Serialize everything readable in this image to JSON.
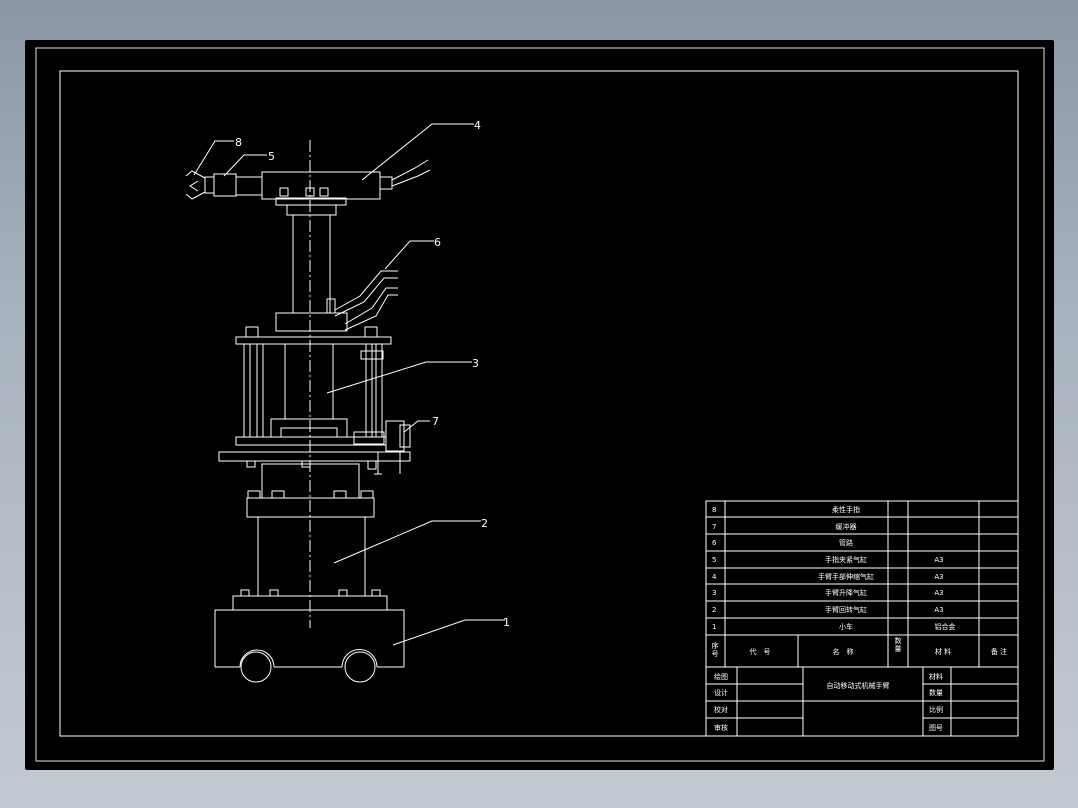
{
  "callouts": [
    {
      "n": "1"
    },
    {
      "n": "2"
    },
    {
      "n": "3"
    },
    {
      "n": "4"
    },
    {
      "n": "5"
    },
    {
      "n": "6"
    },
    {
      "n": "7"
    },
    {
      "n": "8"
    }
  ],
  "bom": [
    {
      "no": "8",
      "name": "柔性手指",
      "material": ""
    },
    {
      "no": "7",
      "name": "缓冲器",
      "material": ""
    },
    {
      "no": "6",
      "name": "管路",
      "material": ""
    },
    {
      "no": "5",
      "name": "手指夹紧气缸",
      "material": "A3"
    },
    {
      "no": "4",
      "name": "手臂手部伸缩气缸",
      "material": "A3"
    },
    {
      "no": "3",
      "name": "手臂升降气缸",
      "material": "A3"
    },
    {
      "no": "2",
      "name": "手臂回转气缸",
      "material": "A3"
    },
    {
      "no": "1",
      "name": "小车",
      "material": "铝合金"
    }
  ],
  "bom_header": {
    "seq": "序号",
    "code": "代　号",
    "name": "名　称",
    "qty": "数量",
    "material": "材 料",
    "remark": "备 注"
  },
  "title_block": {
    "drawn": "绘图",
    "design": "设计",
    "check": "校对",
    "approve": "审核",
    "title": "自动移动式机械手臂",
    "material": "材料",
    "qty": "数量",
    "scale": "比例",
    "drawing_no": "图号"
  },
  "colors": {
    "line": "#ffffff",
    "background": "#000000"
  }
}
